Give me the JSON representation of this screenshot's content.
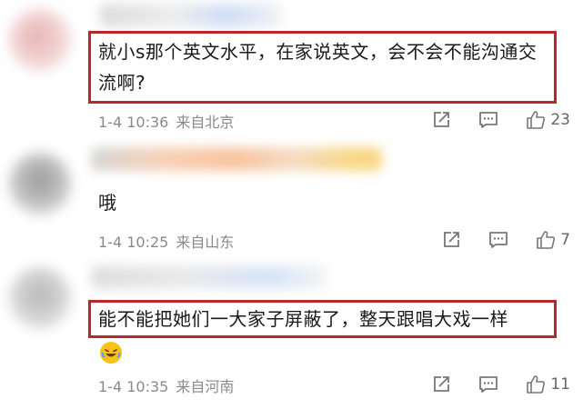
{
  "comments": [
    {
      "text": "就小s那个英文水平，在家说英文，会不会不能沟通交流啊?",
      "date": "1-4 10:36",
      "location": "来自北京",
      "likes": "23"
    },
    {
      "text": "哦",
      "date": "1-4 10:25",
      "location": "来自山东",
      "likes": "7"
    },
    {
      "text": "能不能把她们一大家子屏蔽了，整天跟唱大戏一样",
      "date": "1-4 10:35",
      "location": "来自河南",
      "likes": "11"
    }
  ],
  "icons": {
    "share": "share-icon",
    "reply": "comment-icon",
    "like": "thumbs-up-icon",
    "emoji": "laughing-crying-emoji"
  },
  "colors": {
    "highlight_border": "#b7272c",
    "meta_text": "#8a8a8a"
  }
}
